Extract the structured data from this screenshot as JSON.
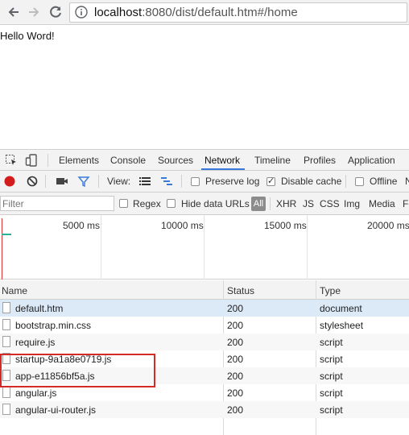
{
  "browser": {
    "url_host": "localhost",
    "url_rest": ":8080/dist/default.htm#/home",
    "back_icon": "back-arrow-icon",
    "forward_icon": "forward-arrow-icon",
    "reload_icon": "reload-icon",
    "info_icon": "info-icon"
  },
  "page": {
    "text": "Hello Word!"
  },
  "devtools": {
    "tabs": [
      "Elements",
      "Console",
      "Sources",
      "Network",
      "Timeline",
      "Profiles",
      "Application"
    ],
    "active_tab": "Network",
    "toolbar": {
      "view_label": "View:",
      "preserve_log": "Preserve log",
      "disable_cache": "Disable cache",
      "offline": "Offline",
      "cut_text": "N"
    },
    "filter": {
      "placeholder": "Filter",
      "regex": "Regex",
      "hide_data_urls": "Hide data URLs",
      "types": [
        "All",
        "XHR",
        "JS",
        "CSS",
        "Img",
        "Media",
        "Fo"
      ]
    },
    "overview_ticks": [
      "5000 ms",
      "10000 ms",
      "15000 ms",
      "20000 ms"
    ],
    "table": {
      "headers": [
        "Name",
        "Status",
        "Type"
      ],
      "rows": [
        {
          "name": "default.htm",
          "status": "200",
          "type": "document"
        },
        {
          "name": "bootstrap.min.css",
          "status": "200",
          "type": "stylesheet"
        },
        {
          "name": "require.js",
          "status": "200",
          "type": "script"
        },
        {
          "name": "startup-9a1a8e0719.js",
          "status": "200",
          "type": "script"
        },
        {
          "name": "app-e11856bf5a.js",
          "status": "200",
          "type": "script"
        },
        {
          "name": "angular.js",
          "status": "200",
          "type": "script"
        },
        {
          "name": "angular-ui-router.js",
          "status": "200",
          "type": "script"
        }
      ]
    }
  }
}
